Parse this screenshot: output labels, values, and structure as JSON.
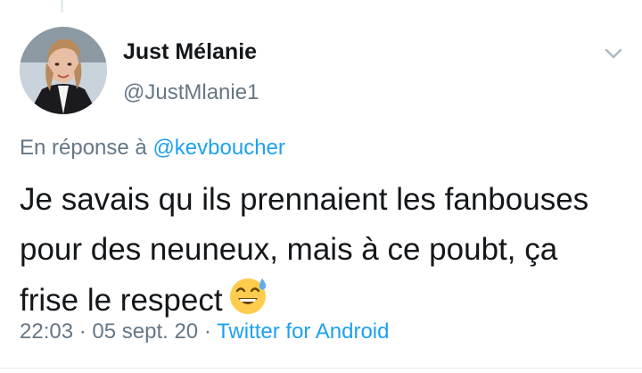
{
  "user": {
    "display_name": "Just Mélanie",
    "handle": "@JustMlanie1"
  },
  "reply": {
    "prefix": "En réponse à ",
    "mention": "@kevboucher"
  },
  "tweet": {
    "text": "Je savais qu ils prennaient les fanbouses pour des neuneux, mais à ce poubt, ça frise le respect",
    "emoji": "grinning-face-with-sweat-icon"
  },
  "meta": {
    "time": "22:03",
    "sep1": " · ",
    "date": "05 sept. 20",
    "sep2": " · ",
    "source": "Twitter for Android"
  },
  "colors": {
    "accent": "#1da1f2",
    "secondary_text": "#657786",
    "primary_text": "#14171a",
    "divider": "#e6ecf0"
  }
}
